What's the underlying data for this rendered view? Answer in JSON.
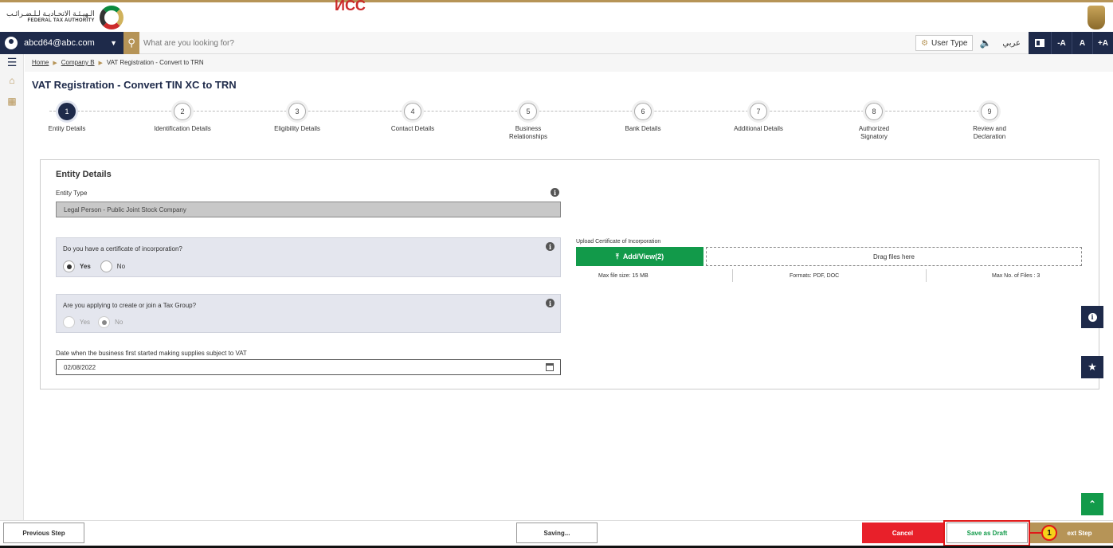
{
  "header": {
    "logo_arabic": "الـهيـئـة الاتحـاديـة لـلـضـرائـب",
    "logo_english": "FEDERAL TAX AUTHORITY",
    "top_accent_text": "ИCC"
  },
  "navbar": {
    "user_email": "abcd64@abc.com",
    "search_placeholder": "What are you looking for?",
    "user_type_label": "User Type",
    "arabic_label": "عربي",
    "font_buttons": [
      "-A",
      "A",
      "+A"
    ]
  },
  "breadcrumb": {
    "items": [
      "Home",
      "Company B",
      "VAT Registration - Convert to TRN"
    ]
  },
  "page": {
    "title": "VAT Registration - Convert TIN XC to TRN"
  },
  "stepper": {
    "active_step": 1,
    "steps": [
      {
        "num": "1",
        "label": "Entity Details"
      },
      {
        "num": "2",
        "label": "Identification Details"
      },
      {
        "num": "3",
        "label": "Eligibility Details"
      },
      {
        "num": "4",
        "label": "Contact Details"
      },
      {
        "num": "5",
        "label": "Business Relationships"
      },
      {
        "num": "6",
        "label": "Bank Details"
      },
      {
        "num": "7",
        "label": "Additional Details"
      },
      {
        "num": "8",
        "label": "Authorized Signatory"
      },
      {
        "num": "9",
        "label": "Review and Declaration"
      }
    ]
  },
  "form": {
    "section_title": "Entity Details",
    "entity_type_label": "Entity Type",
    "entity_type_value": "Legal Person - Public Joint Stock Company",
    "q_certificate": "Do you have a certificate of incorporation?",
    "q_certificate_yes": "Yes",
    "q_certificate_no": "No",
    "q_certificate_value": "Yes",
    "q_tax_group": "Are you applying to create or join a Tax Group?",
    "q_tax_group_yes": "Yes",
    "q_tax_group_no": "No",
    "q_tax_group_value": "No",
    "date_label": "Date when the business first started making supplies subject to VAT",
    "date_value": "02/08/2022"
  },
  "upload": {
    "label": "Upload Certificate of Incorporation",
    "button_label": "Add/View(2)",
    "drop_label": "Drag files here",
    "max_size": "Max file size: 15 MB",
    "formats": "Formats: PDF, DOC",
    "max_files": "Max No. of Files : 3"
  },
  "footer": {
    "previous_label": "Previous Step",
    "saving_label": "Saving...",
    "cancel_label": "Cancel",
    "draft_label": "Save as Draft",
    "next_label": "ext Step",
    "callout_number": "1"
  },
  "colors": {
    "navy": "#1e2a4a",
    "gold": "#b69457",
    "green": "#129a4a",
    "red": "#e8202a",
    "highlight": "#e01818",
    "callout_fill": "#f5d21a"
  }
}
